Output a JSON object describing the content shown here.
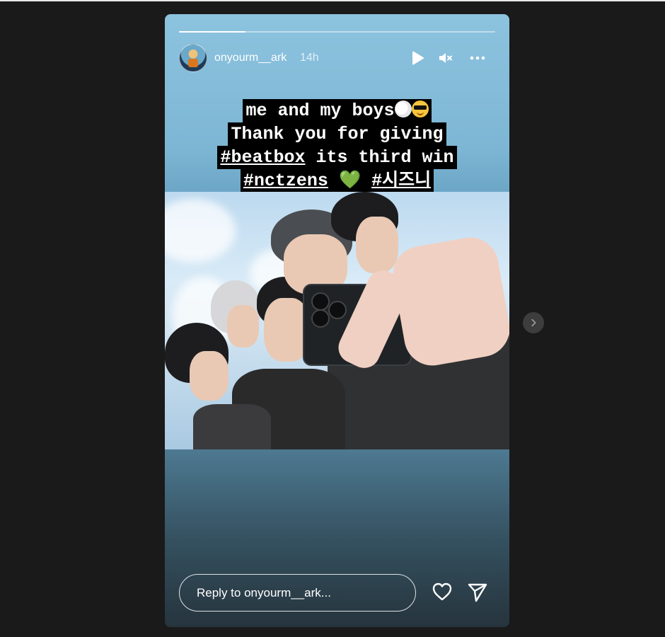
{
  "story": {
    "username": "onyourm__ark",
    "time": "14h",
    "progress": 0.21,
    "caption": {
      "line1": "me and my boys",
      "line2": "Thank you for giving",
      "line3_tag": "#beatbox",
      "line3_rest": " its third win ",
      "line4_tag1": "#nctzens",
      "line4_heart": " 💚 ",
      "line4_tag2": "#시즈니"
    },
    "reply_placeholder": "Reply to onyourm__ark..."
  },
  "icons": {
    "play": "play-icon",
    "mute": "mute-icon",
    "more": "more-icon",
    "like": "heart-icon",
    "share": "send-icon",
    "next": "chevron-right-icon"
  }
}
